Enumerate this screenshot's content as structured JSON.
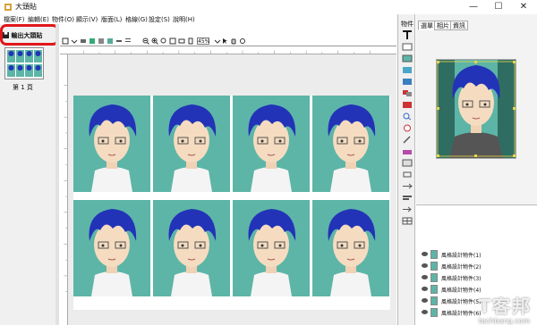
{
  "window": {
    "title": "大頭貼"
  },
  "menu": [
    "檔案(F)",
    "編輯(E)",
    "物件(O)",
    "顯示(V)",
    "版面(L)",
    "格線(G)",
    "設定(S)",
    "說明(H)"
  ],
  "left_pane": {
    "export_label": "輸出大頭貼",
    "page_label": "第 1 頁"
  },
  "toolbar": {
    "zoom": "45%"
  },
  "tools": {
    "label": "物件"
  },
  "right_panel": {
    "tabs": [
      "選單",
      "相片",
      "資訊"
    ]
  },
  "layers": [
    "風格設計物件(1)",
    "風格設計物件(2)",
    "風格設計物件(3)",
    "風格設計物件(4)",
    "風格設計物件(5)",
    "風格設計物件(6)"
  ],
  "watermark": {
    "main": "T客邦",
    "sub": "techbang.com"
  },
  "colors": {
    "photo_bg": "#5db5a7",
    "hair": "#2233b8",
    "highlight": "#e0161a"
  }
}
